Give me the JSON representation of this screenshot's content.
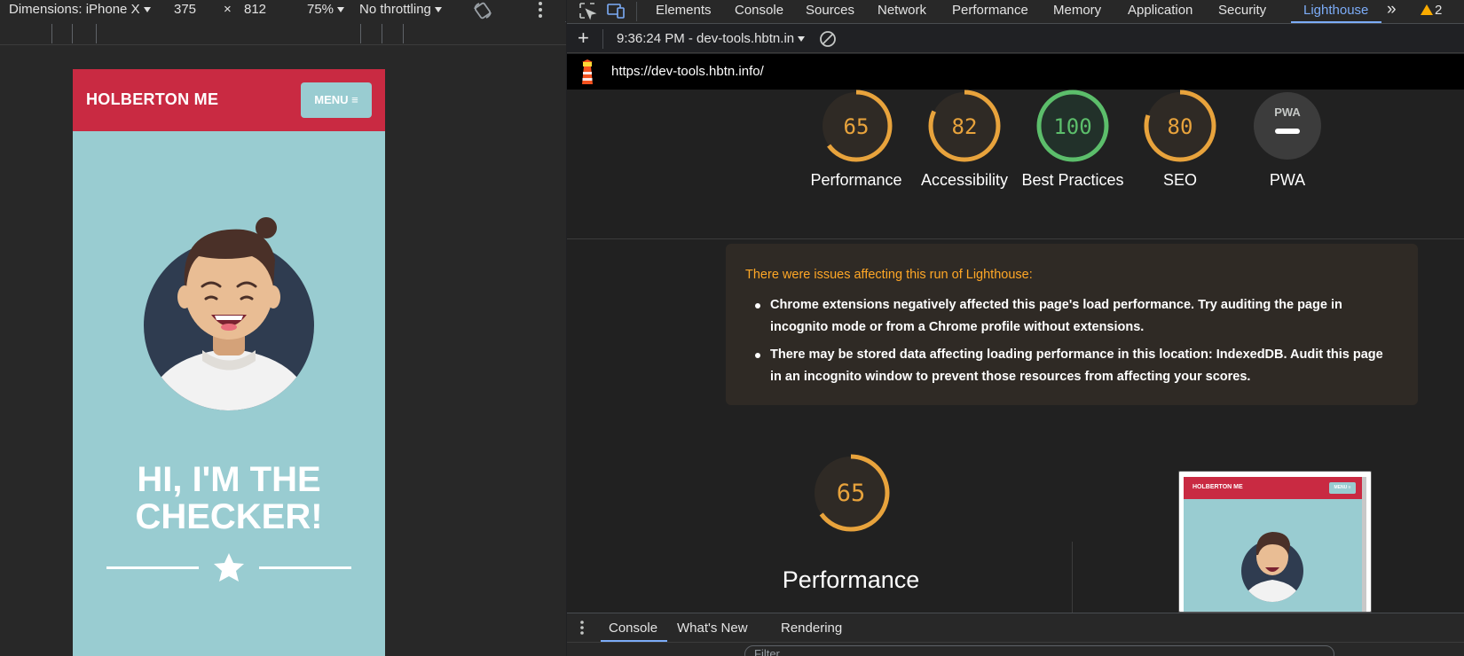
{
  "device_toolbar": {
    "dimensions_label": "Dimensions: iPhone X",
    "width": "375",
    "times": "×",
    "height": "812",
    "zoom": "75%",
    "throttling": "No throttling"
  },
  "phone": {
    "brand": "HOLBERTON ME",
    "menu_label": "MENU ≡",
    "hero_line1": "HI, I'M THE",
    "hero_line2": "CHECKER!"
  },
  "devtools": {
    "tabs": [
      "Elements",
      "Console",
      "Sources",
      "Network",
      "Performance",
      "Memory",
      "Application",
      "Security",
      "Lighthouse"
    ],
    "active_tab": "Lighthouse",
    "more_tabs": "»",
    "warning_count": "2",
    "lighthouse_bar": {
      "add": "+",
      "report_selector": "9:36:24 PM - dev-tools.hbtn.in"
    },
    "url": "https://dev-tools.hbtn.info/"
  },
  "report": {
    "gauges": [
      {
        "score": "65",
        "label": "Performance",
        "color": "#e8a33c",
        "fraction": 0.65
      },
      {
        "score": "82",
        "label": "Accessibility",
        "color": "#e8a33c",
        "fraction": 0.82
      },
      {
        "score": "100",
        "label": "Best Practices",
        "color": "#5cbe6b",
        "fraction": 1.0
      },
      {
        "score": "80",
        "label": "SEO",
        "color": "#e8a33c",
        "fraction": 0.8
      },
      {
        "score": "PWA",
        "label": "PWA",
        "color": "#ffffff",
        "fraction": 0
      }
    ],
    "warning_title": "There were issues affecting this run of Lighthouse:",
    "warnings": [
      "Chrome extensions negatively affected this page's load performance. Try auditing the page in incognito mode or from a Chrome profile without extensions.",
      "There may be stored data affecting loading performance in this location: IndexedDB. Audit this page in an incognito window to prevent those resources from affecting your scores."
    ],
    "perf_score": "65",
    "perf_label": "Performance",
    "thumb": {
      "brand": "HOLBERTON ME",
      "menu": "MENU ≡"
    }
  },
  "drawer": {
    "tabs": [
      "Console",
      "What's New",
      "Rendering"
    ],
    "filter_placeholder": "Filter"
  }
}
